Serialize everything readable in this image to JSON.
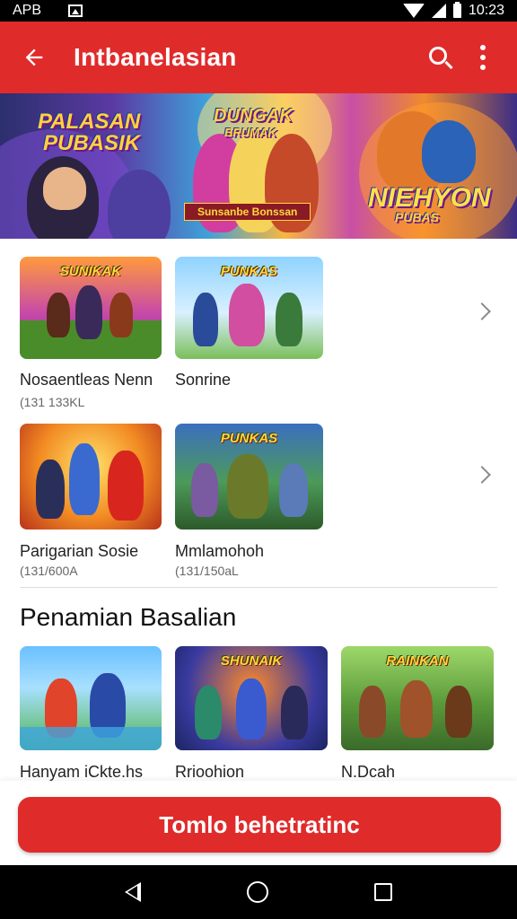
{
  "status_bar": {
    "carrier": "APB",
    "time": "10:23"
  },
  "app_bar": {
    "title": "Intbanelasian"
  },
  "banner": {
    "text_left_line1": "PALASAN",
    "text_left_line2": "PUBASIK",
    "text_center_top": "DUNGAK",
    "text_center_sub": "BRUMAK",
    "ribbon": "Sunsanbe Bonssan",
    "text_right_line1": "NIEHYON",
    "text_right_line2": "PUBAS"
  },
  "games": [
    {
      "title": "Nosaentleas Nenn",
      "subtitle": "(131 133KL",
      "art_label": "SUNIKAK"
    },
    {
      "title": "Sonrine",
      "subtitle": "",
      "art_label": "PUNKAS"
    },
    {
      "title": "Parigarian Sosie",
      "subtitle": "(131/600A",
      "art_label": ""
    },
    {
      "title": "Mmlamohoh",
      "subtitle": "(131/150aL",
      "art_label": "PUNKAS"
    }
  ],
  "section": {
    "title": "Penamian Basalian"
  },
  "recommended": [
    {
      "title": "Hanyam iCkte.hs",
      "art_label": ""
    },
    {
      "title": "Rrioohion",
      "art_label": "SHUNAIK"
    },
    {
      "title": "N.Dcah",
      "art_label": "RAINKAN"
    }
  ],
  "cta": {
    "label": "Tomlo behetratinc"
  },
  "colors": {
    "primary": "#e02b2b",
    "status_bar": "#000000"
  },
  "icons": [
    "back-arrow-icon",
    "search-icon",
    "more-vert-icon",
    "chevron-right-icon",
    "nav-back-icon",
    "nav-home-icon",
    "nav-recents-icon"
  ]
}
